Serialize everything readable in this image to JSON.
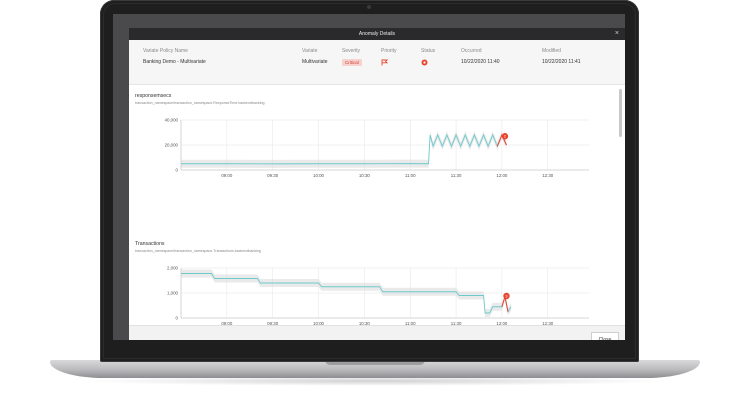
{
  "dialog": {
    "title": "Anomaly Details",
    "close_label": "Close"
  },
  "summary": {
    "policy": {
      "label": "Variate Policy Name",
      "value": "Banking Demo - Multivariate"
    },
    "variate": {
      "label": "Variate",
      "value": "Multivariate"
    },
    "severity": {
      "label": "Severity",
      "value": "Critical"
    },
    "priority": {
      "label": "Priority",
      "icon": "flag-icon",
      "color": "#e8452c"
    },
    "status": {
      "label": "Status",
      "icon": "status-circle-icon",
      "color": "#e8452c"
    },
    "occurred": {
      "label": "Occurred",
      "value": "10/22/2020 11:40"
    },
    "modified": {
      "label": "Modified",
      "value": "10/22/2020 11:41"
    }
  },
  "colors": {
    "series": "#6cc9cc",
    "band": "#d8d8d8",
    "anomaly": "#e8452c",
    "grid": "#e4e4e4"
  },
  "chart_data": [
    {
      "type": "line",
      "title": "responsemsecs",
      "subtitle": "transaction_namespace/transaction_namespace.ResponseTime.backendbanking",
      "y_ticks": [
        "40,000",
        "20,000",
        "0"
      ],
      "ylim": [
        0,
        40000
      ],
      "x_ticks": [
        "09:00",
        "09:30",
        "10:00",
        "10:30",
        "11:00",
        "11:30",
        "12:00",
        "12:30"
      ],
      "x_range_minutes": [
        510,
        777
      ],
      "series": [
        {
          "points": [
            [
              510,
              5000
            ],
            [
              540,
              5000
            ],
            [
              570,
              4900
            ],
            [
              600,
              5000
            ],
            [
              630,
              5000
            ],
            [
              660,
              5100
            ],
            [
              672,
              5000
            ],
            [
              673,
              28000
            ],
            [
              675,
              19000
            ],
            [
              678,
              28000
            ],
            [
              681,
              19000
            ],
            [
              684,
              28000
            ],
            [
              687,
              19000
            ],
            [
              690,
              28000
            ],
            [
              693,
              19000
            ],
            [
              696,
              28000
            ],
            [
              699,
              19000
            ],
            [
              702,
              28000
            ],
            [
              705,
              19000
            ],
            [
              708,
              28000
            ],
            [
              711,
              19000
            ],
            [
              714,
              28000
            ],
            [
              717,
              19000
            ],
            [
              720,
              28000
            ],
            [
              723,
              20000
            ]
          ]
        }
      ],
      "anomaly": {
        "x": 722,
        "y": 27000,
        "count": "2",
        "segment": [
          [
            717,
            19000
          ],
          [
            720,
            28000
          ],
          [
            723,
            20000
          ]
        ]
      }
    },
    {
      "type": "line",
      "title": "Transactions",
      "subtitle": "transaction_namespace/transaction_namespace.Transactions.backendbanking",
      "y_ticks": [
        "2,000",
        "1,000",
        "0"
      ],
      "ylim": [
        0,
        2000
      ],
      "x_ticks": [
        "09:00",
        "09:30",
        "10:00",
        "10:30",
        "11:00",
        "11:30",
        "12:00",
        "12:30"
      ],
      "x_range_minutes": [
        510,
        777
      ],
      "series": [
        {
          "points": [
            [
              510,
              1780
            ],
            [
              530,
              1780
            ],
            [
              532,
              1580
            ],
            [
              560,
              1580
            ],
            [
              562,
              1400
            ],
            [
              600,
              1400
            ],
            [
              602,
              1250
            ],
            [
              640,
              1250
            ],
            [
              642,
              1050
            ],
            [
              690,
              1050
            ],
            [
              692,
              900
            ],
            [
              708,
              900
            ],
            [
              709,
              200
            ],
            [
              712,
              200
            ],
            [
              714,
              450
            ],
            [
              720,
              450
            ],
            [
              722,
              850
            ],
            [
              724,
              250
            ],
            [
              726,
              450
            ]
          ]
        }
      ],
      "anomaly": {
        "x": 723,
        "y": 880,
        "count": "3",
        "segment": [
          [
            720,
            450
          ],
          [
            722,
            850
          ],
          [
            724,
            250
          ]
        ]
      }
    }
  ]
}
